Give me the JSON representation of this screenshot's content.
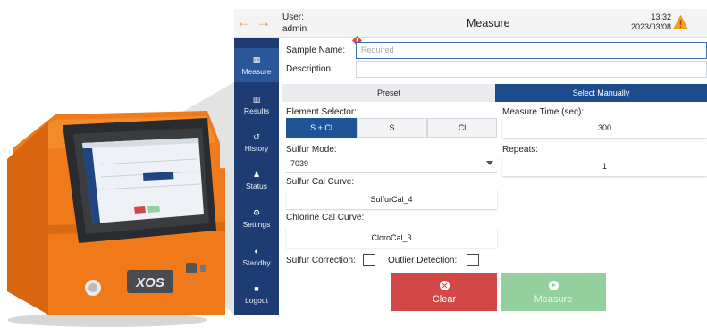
{
  "header": {
    "user_label": "User:",
    "user_name": "admin",
    "title": "Measure",
    "time": "13:32",
    "date": "2023/03/08"
  },
  "sidebar": {
    "items": [
      {
        "label": "Measure",
        "icon": "measure-icon"
      },
      {
        "label": "Results",
        "icon": "results-icon"
      },
      {
        "label": "History",
        "icon": "history-icon"
      },
      {
        "label": "Status",
        "icon": "status-icon"
      },
      {
        "label": "Settings",
        "icon": "settings-icon"
      },
      {
        "label": "Standby",
        "icon": "standby-icon"
      },
      {
        "label": "Logout",
        "icon": "logout-icon"
      }
    ]
  },
  "form": {
    "sample_name_label": "Sample Name:",
    "sample_name_placeholder": "Required",
    "description_label": "Description:",
    "tabs": {
      "preset": "Preset",
      "manual": "Select Manually"
    },
    "element_selector_label": "Element Selector:",
    "element_options": [
      "S + Cl",
      "S",
      "Cl"
    ],
    "measure_time_label": "Measure Time (sec):",
    "measure_time_value": "300",
    "sulfur_mode_label": "Sulfur Mode:",
    "sulfur_mode_value": "7039",
    "repeats_label": "Repeats:",
    "repeats_value": "1",
    "sulfur_cal_label": "Sulfur Cal Curve:",
    "sulfur_cal_value": "SulfurCal_4",
    "chlorine_cal_label": "Chlorine Cal Curve:",
    "chlorine_cal_value": "CloroCal_3",
    "sulfur_correction_label": "Sulfur Correction:",
    "outlier_detection_label": "Outlier Detection:"
  },
  "actions": {
    "clear_label": "Clear",
    "measure_label": "Measure"
  },
  "device": {
    "logo_text": "XOS"
  },
  "colors": {
    "sidebar": "#1c3c73",
    "tab_active": "#1e4b8c",
    "clear": "#d24848",
    "measure": "#93d09d",
    "device_orange": "#f07a1a"
  }
}
